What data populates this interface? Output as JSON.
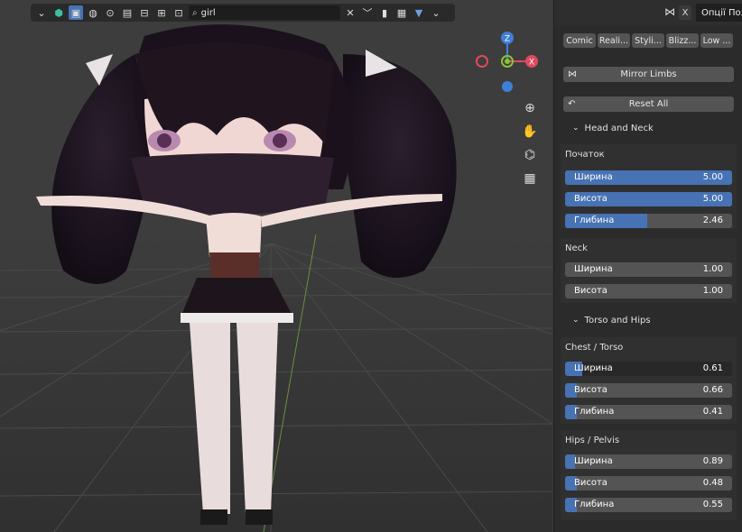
{
  "toolbar": {
    "search_value": "girl",
    "icons": [
      "chevron-down-icon",
      "object-icon",
      "select-box-icon",
      "globe-icon",
      "link-icon",
      "brush-icon",
      "layout-icon",
      "compositor-icon",
      "search-icon",
      "clear-icon",
      "dropdown-icon",
      "bookmark-icon",
      "columns-icon",
      "filter-icon"
    ]
  },
  "gizmo": {
    "z": "Z",
    "x": "X"
  },
  "panel": {
    "header_x": "X",
    "tab_label": "Опції Поз",
    "presets": [
      "Comic",
      "Reali...",
      "Styli...",
      "Blizz...",
      "Low ..."
    ],
    "mirror_limbs": "Mirror Limbs",
    "reset_all": "Reset All",
    "sections": [
      {
        "title": "Head and Neck",
        "groups": [
          {
            "title": "Початок",
            "sliders": [
              {
                "label": "Ширина",
                "value": "5.00",
                "fill": 1.0
              },
              {
                "label": "Висота",
                "value": "5.00",
                "fill": 1.0
              },
              {
                "label": "Глибина",
                "value": "2.46",
                "fill": 0.49
              }
            ]
          },
          {
            "title": "Neck",
            "sliders": [
              {
                "label": "Ширина",
                "value": "1.00",
                "fill": 0.0
              },
              {
                "label": "Висота",
                "value": "1.00",
                "fill": 0.0
              }
            ]
          }
        ]
      },
      {
        "title": "Torso and Hips",
        "groups": [
          {
            "title": "Chest / Torso",
            "sliders": [
              {
                "label": "Ширина",
                "value": "0.61",
                "fill": 0.1
              },
              {
                "label": "Висота",
                "value": "0.66",
                "fill": 0.07
              },
              {
                "label": "Глибина",
                "value": "0.41",
                "fill": 0.07
              }
            ]
          },
          {
            "title": "Hips / Pelvis",
            "sliders": [
              {
                "label": "Ширина",
                "value": "0.89",
                "fill": 0.06
              },
              {
                "label": "Висота",
                "value": "0.48",
                "fill": 0.07
              },
              {
                "label": "Глибина",
                "value": "0.55",
                "fill": 0.07
              }
            ]
          }
        ]
      }
    ]
  },
  "colors": {
    "accent": "#4772b3",
    "panel_bg": "#2b2b2b",
    "viewport_bg": "#3d3d3d",
    "slider_bg": "#545454",
    "axis_x": "#e04a5e",
    "axis_y": "#8ac23a",
    "axis_z": "#3f7fd8"
  }
}
